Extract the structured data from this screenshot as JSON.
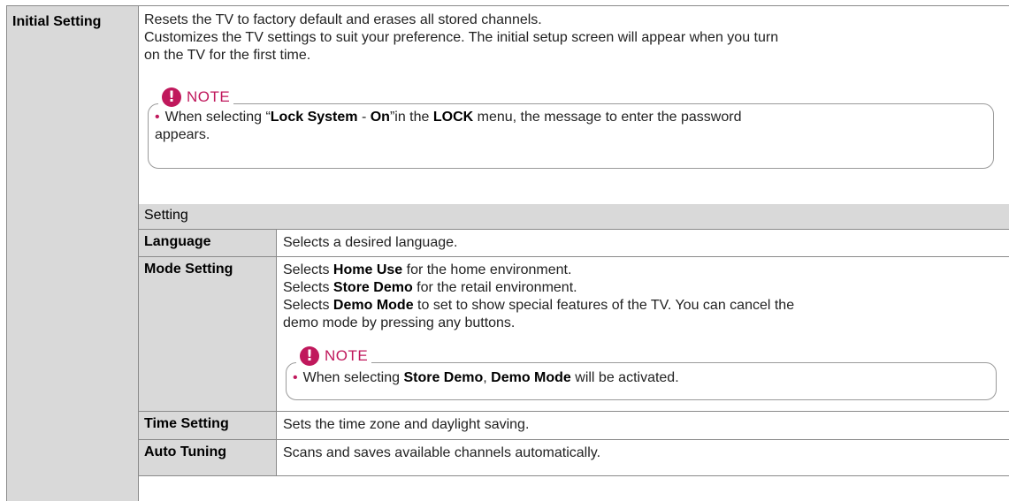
{
  "term": "Initial Setting",
  "description": {
    "line1": "Resets the TV to factory default and erases all stored channels.",
    "line2": "Customizes the TV settings to suit your preference. The initial setup screen will appear when you turn",
    "line3": "on the TV for the first time."
  },
  "note1": {
    "icon": "!",
    "label": "NOTE",
    "bullet": "•",
    "parts": [
      "When selecting “",
      "Lock System",
      " - ",
      "On",
      "”in the ",
      "LOCK",
      " menu, the message to enter the password"
    ],
    "line2": "appears."
  },
  "sub_heading": "Setting",
  "rows": [
    {
      "label": "Language",
      "text": "Selects a desired language."
    },
    {
      "label": "Mode Setting",
      "lines": [
        {
          "pre": "Selects ",
          "bold": "Home Use",
          "post": " for the home environment."
        },
        {
          "pre": "Selects ",
          "bold": "Store Demo",
          "post": " for the retail environment."
        },
        {
          "pre": "Selects ",
          "bold": "Demo Mode",
          "post": " to set to show special features of the TV. You can cancel the"
        }
      ],
      "line4": "demo mode by pressing any buttons."
    },
    {
      "label": "Time Setting",
      "text": "Sets the time zone and daylight saving."
    },
    {
      "label": "Auto Tuning",
      "text": "Scans and saves available channels automatically."
    }
  ],
  "note2": {
    "icon": "!",
    "label": "NOTE",
    "bullet": "•",
    "parts": [
      "When selecting ",
      "Store Demo",
      ", ",
      "Demo Mode",
      " will be activated."
    ]
  }
}
